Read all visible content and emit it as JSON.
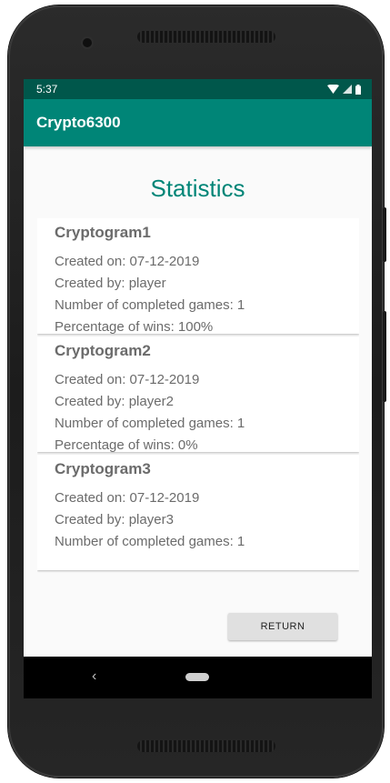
{
  "status_bar": {
    "time": "5:37"
  },
  "app_bar": {
    "title": "Crypto6300"
  },
  "page": {
    "title": "Statistics"
  },
  "cryptograms": [
    {
      "name": "Cryptogram1",
      "created_on": "Created on: 07-12-2019",
      "created_by": "Created by: player",
      "completed_games": "Number of completed games: 1",
      "win_percentage": "Percentage of wins: 100%"
    },
    {
      "name": "Cryptogram2",
      "created_on": "Created on: 07-12-2019",
      "created_by": "Created by: player2",
      "completed_games": "Number of completed games: 1",
      "win_percentage": "Percentage of wins: 0%"
    },
    {
      "name": "Cryptogram3",
      "created_on": "Created on: 07-12-2019",
      "created_by": "Created by: player3",
      "completed_games": "Number of completed games: 1"
    }
  ],
  "buttons": {
    "return_label": "RETURN"
  },
  "nav": {
    "back_glyph": "‹"
  },
  "icons": {
    "wifi": "wifi-icon",
    "signal": "signal-icon",
    "battery": "battery-icon",
    "back": "back-icon",
    "home": "home-icon"
  },
  "colors": {
    "primary": "#008577",
    "primary_dark": "#00574b",
    "button": "#e0e0e0"
  }
}
